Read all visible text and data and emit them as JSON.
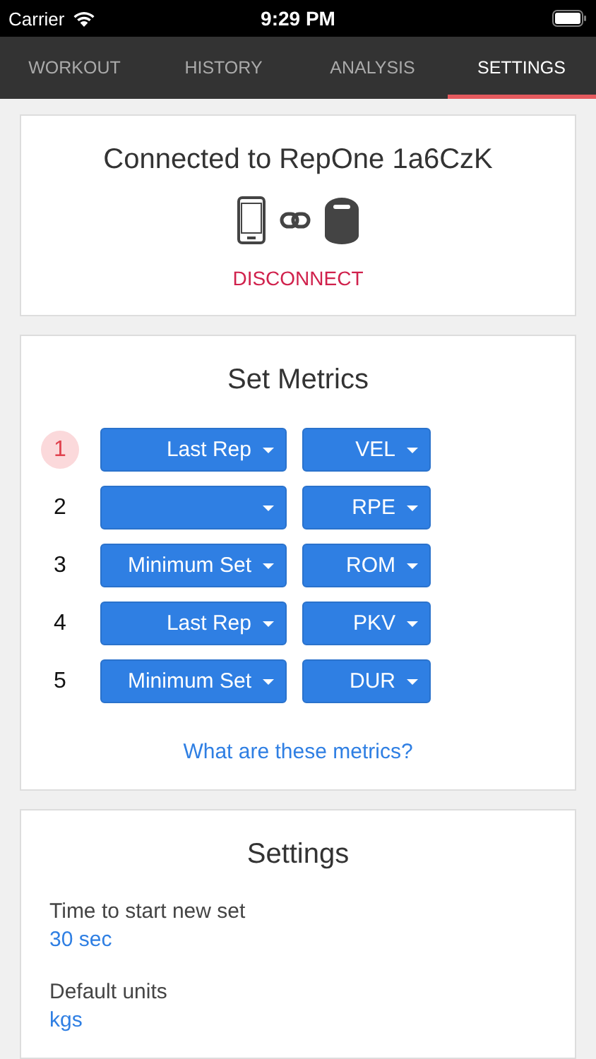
{
  "status_bar": {
    "carrier": "Carrier",
    "time": "9:29 PM"
  },
  "tabs": [
    {
      "label": "WORKOUT",
      "selected": false
    },
    {
      "label": "HISTORY",
      "selected": false
    },
    {
      "label": "ANALYSIS",
      "selected": false
    },
    {
      "label": "SETTINGS",
      "selected": true
    }
  ],
  "connection": {
    "title": "Connected to RepOne 1a6CzK",
    "action": "DISCONNECT"
  },
  "set_metrics": {
    "title": "Set Metrics",
    "rows": [
      {
        "number": "1",
        "selected": true,
        "aggregate": "Last Rep",
        "metric": "VEL"
      },
      {
        "number": "2",
        "selected": false,
        "metric": "RPE"
      },
      {
        "number": "3",
        "selected": false,
        "aggregate": "Minimum Set",
        "metric": "ROM"
      },
      {
        "number": "4",
        "selected": false,
        "aggregate": "Last Rep",
        "metric": "PKV"
      },
      {
        "number": "5",
        "selected": false,
        "aggregate": "Minimum Set",
        "metric": "DUR"
      }
    ],
    "help_link": "What are these metrics?"
  },
  "settings": {
    "title": "Settings",
    "items": [
      {
        "label": "Time to start new set",
        "value": "30 sec"
      },
      {
        "label": "Default units",
        "value": "kgs"
      }
    ]
  }
}
